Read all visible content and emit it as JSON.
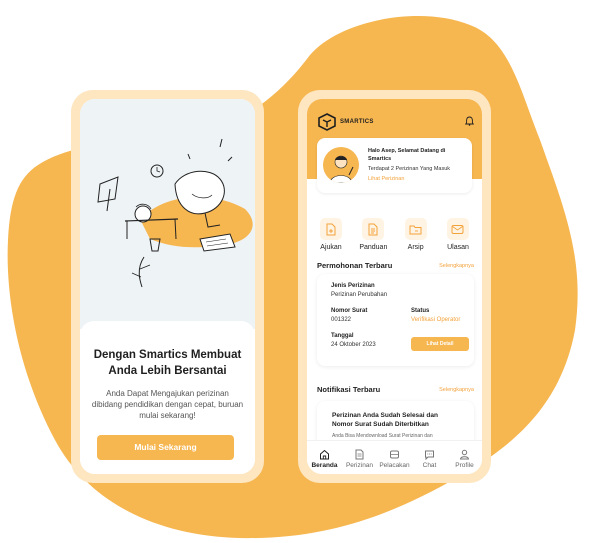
{
  "onboarding": {
    "title": "Dengan Smartics Membuat Anda Lebih Bersantai",
    "description": "Anda Dapat Mengajukan perizinan dibidang pendidikan dengan cepat, buruan mulai sekarang!",
    "cta_label": "Mulai Sekarang"
  },
  "home": {
    "logo_text": "SMARTICS",
    "greeting": {
      "title": "Halo Asep, Selamat Datang di Smartics",
      "subtitle": "Terdapat 2 Perizinan Yang Masuk",
      "link": "Lihat Perizinan"
    },
    "menu": [
      {
        "label": "Ajukan",
        "icon": "file-add-icon"
      },
      {
        "label": "Panduan",
        "icon": "document-icon"
      },
      {
        "label": "Arsip",
        "icon": "folder-icon"
      },
      {
        "label": "Ulasan",
        "icon": "message-icon"
      }
    ],
    "requests": {
      "title": "Permohonan Terbaru",
      "see_all": "Selengkapnya",
      "item": {
        "type_label": "Jenis Perizinan",
        "type_value": "Perizinan Perubahan",
        "number_label": "Nomor Surat",
        "number_value": "001322",
        "status_label": "Status",
        "status_value": "Verifikasi Operator",
        "date_label": "Tanggal",
        "date_value": "24 Oktober 2023",
        "detail_label": "Lihat Detail"
      }
    },
    "notifications": {
      "title": "Notifikasi Terbaru",
      "see_all": "Selengkapnya",
      "item": {
        "title": "Perizinan Anda Sudah Selesai dan Nomor Surat Sudah Diterbitkan",
        "description": "Anda Bisa Mendownload Surat Perizinan dan Memberikan Ulasan Terkait Pelayanan Smartics"
      }
    },
    "tabs": [
      {
        "label": "Beranda",
        "icon": "home-icon",
        "active": true
      },
      {
        "label": "Perizinan",
        "icon": "document-icon",
        "active": false
      },
      {
        "label": "Pelacakan",
        "icon": "scan-icon",
        "active": false
      },
      {
        "label": "Chat",
        "icon": "chat-icon",
        "active": false
      },
      {
        "label": "Profile",
        "icon": "user-icon",
        "active": false
      }
    ]
  },
  "colors": {
    "accent": "#f6b650",
    "accent_text": "#f3a23b",
    "frame": "#fde6c0"
  }
}
